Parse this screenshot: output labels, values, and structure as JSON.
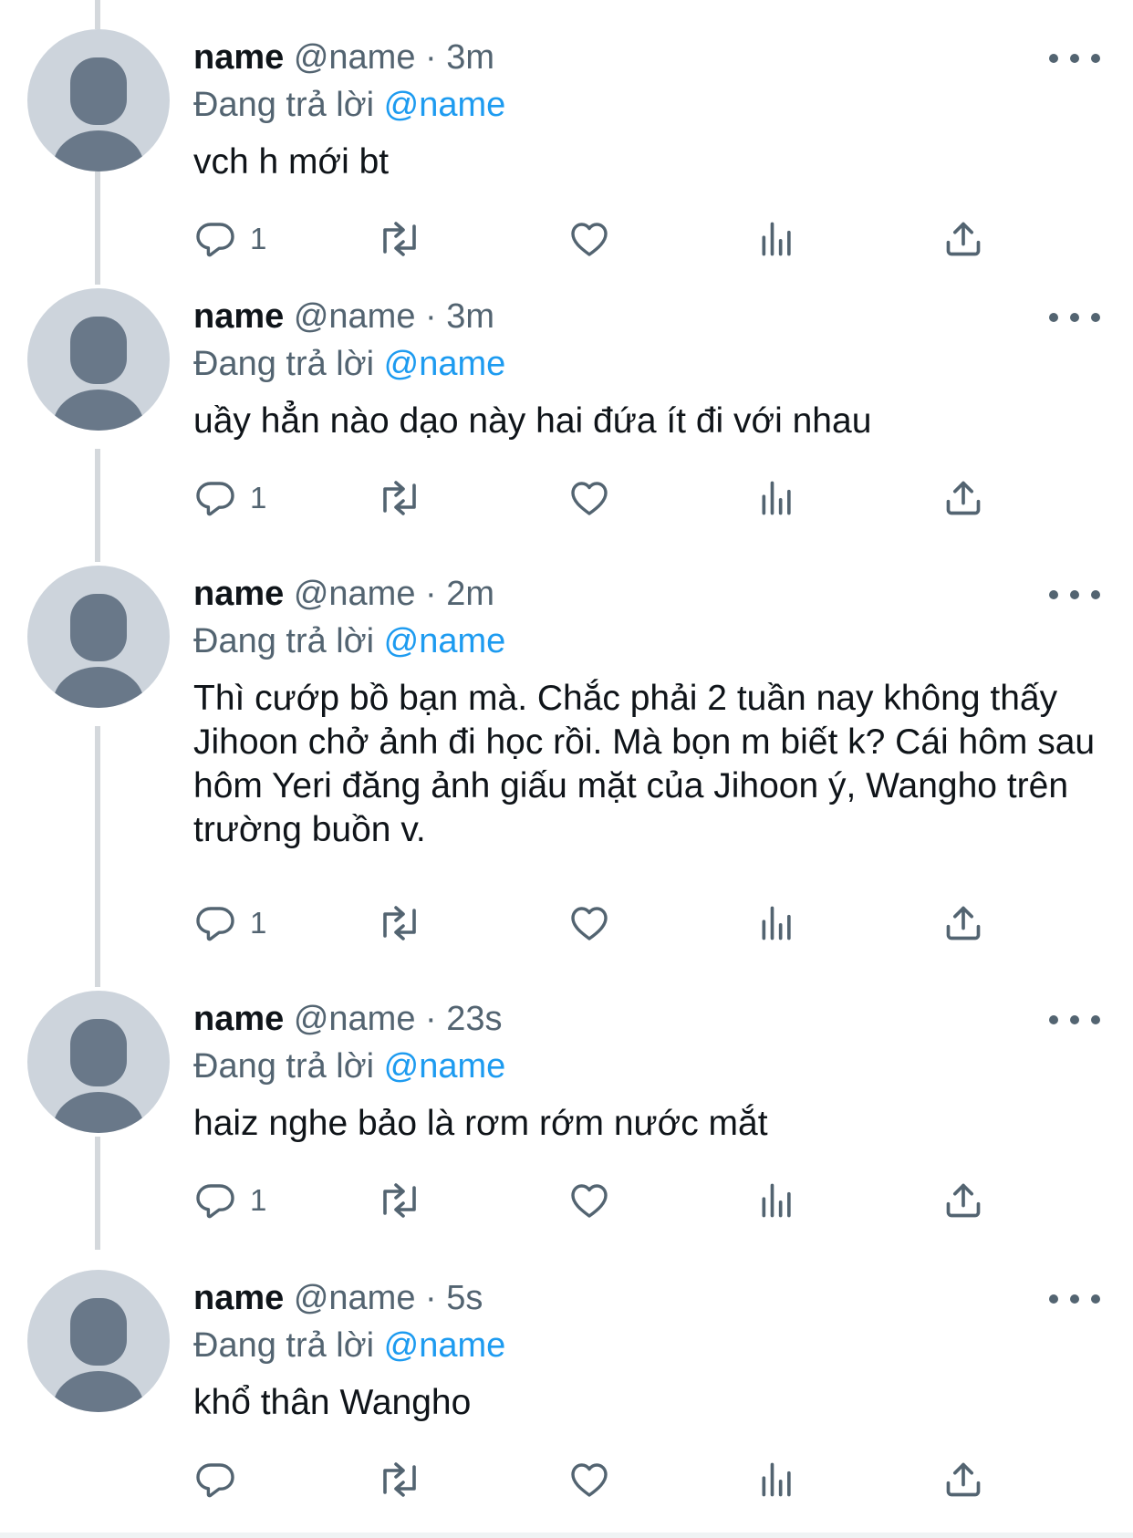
{
  "reply_prefix": "Đang trả lời",
  "colors": {
    "text": "#0f1419",
    "secondary": "#536471",
    "link": "#1d9bf0",
    "avatar_bg": "#cdd4dc",
    "avatar_fg": "#697889",
    "thread_line": "#d4d8dc"
  },
  "tweets": [
    {
      "name": "name",
      "handle": "@name",
      "time": "3m",
      "reply_to": "@name",
      "text": "vch h mới bt",
      "reply_count": "1"
    },
    {
      "name": "name",
      "handle": "@name",
      "time": "3m",
      "reply_to": "@name",
      "text": "uầy hẳn nào dạo này hai đứa ít đi với nhau",
      "reply_count": "1"
    },
    {
      "name": "name",
      "handle": "@name",
      "time": "2m",
      "reply_to": "@name",
      "text": "Thì cướp bồ bạn mà. Chắc phải 2 tuần nay không thấy Jihoon chở ảnh đi học rồi. Mà bọn m biết k? Cái hôm sau hôm Yeri đăng ảnh giấu mặt của Jihoon ý, Wangho trên trường buồn v.",
      "reply_count": "1"
    },
    {
      "name": "name",
      "handle": "@name",
      "time": "23s",
      "reply_to": "@name",
      "text": "haiz nghe bảo là rơm rớm nước mắt",
      "reply_count": "1"
    },
    {
      "name": "name",
      "handle": "@name",
      "time": "5s",
      "reply_to": "@name",
      "text": "khổ thân Wangho",
      "reply_count": ""
    }
  ]
}
